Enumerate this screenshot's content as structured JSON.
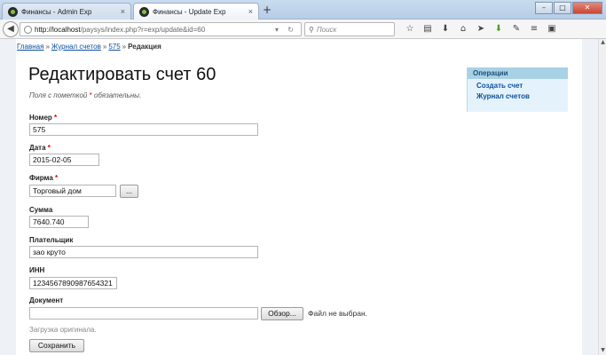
{
  "browser": {
    "tabs": [
      {
        "title": "Финансы - Admin Exp",
        "close": "×"
      },
      {
        "title": "Финансы - Update Exp",
        "close": "×"
      }
    ],
    "new_tab": "+",
    "window_buttons": {
      "minimize": "–",
      "maximize": "□",
      "close": "✕"
    },
    "url": {
      "host": "http://localhost",
      "path": "/paysys/index.php?r=exp/update&id=60"
    },
    "search_placeholder": "Поиск"
  },
  "breadcrumb": {
    "home": "Главная",
    "journal": "Журнал счетов",
    "item": "575",
    "current": "Редакция",
    "separator": "»"
  },
  "page": {
    "title": "Редактировать счет 60",
    "required_note_prefix": "Поля с пометкой",
    "required_mark": "*",
    "required_note_suffix": "обязательны."
  },
  "form": {
    "number": {
      "label": "Номер",
      "value": "575"
    },
    "date": {
      "label": "Дата",
      "value": "2015-02-05"
    },
    "firm": {
      "label": "Фирма",
      "value": "Торговый дом",
      "button": "..."
    },
    "sum": {
      "label": "Сумма",
      "value": "7640.740"
    },
    "payer": {
      "label": "Плательщик",
      "value": "зао круто"
    },
    "inn": {
      "label": "ИНН",
      "value": "1234567890987654321"
    },
    "document": {
      "label": "Документ",
      "browse": "Обзор...",
      "no_file": "Файл не выбран."
    },
    "upload_hint": "Загрузка оригинала.",
    "save": "Сохранить"
  },
  "operations": {
    "title": "Операции",
    "items": [
      "Создать счет",
      "Журнал счетов"
    ]
  }
}
